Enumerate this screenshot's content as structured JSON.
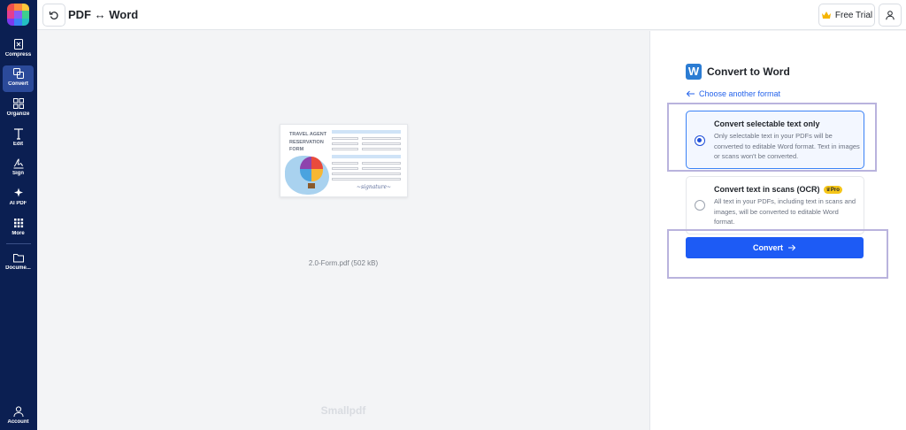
{
  "header": {
    "title": "PDF ↔ Word",
    "free_trial_label": "Free Trial"
  },
  "sidebar": {
    "items": [
      {
        "label": "Compress",
        "icon": "compress-icon"
      },
      {
        "label": "Convert",
        "icon": "convert-icon",
        "active": true
      },
      {
        "label": "Organize",
        "icon": "organize-icon"
      },
      {
        "label": "Edit",
        "icon": "edit-icon"
      },
      {
        "label": "Sign",
        "icon": "sign-icon"
      },
      {
        "label": "AI PDF",
        "icon": "ai-sparkle-icon"
      },
      {
        "label": "More",
        "icon": "grid-icon"
      },
      {
        "label": "Docume...",
        "icon": "folder-icon"
      },
      {
        "label": "Account",
        "icon": "account-icon"
      }
    ]
  },
  "preview": {
    "thumbnail_title": "TRAVEL AGENT RESERVATION FORM",
    "file_name": "2.0-Form.pdf (502 kB)",
    "watermark": "Smallpdf"
  },
  "panel": {
    "title": "Convert to Word",
    "choose_link": "Choose another format",
    "options": [
      {
        "title": "Convert selectable text only",
        "description": "Only selectable text in your PDFs will be converted to editable Word format. Text in images or scans won't be converted.",
        "selected": true
      },
      {
        "title": "Convert text in scans (OCR)",
        "badge": "Pro",
        "description": "All text in your PDFs, including text in scans and images, will be converted to editable Word format.",
        "selected": false
      }
    ],
    "convert_label": "Convert"
  },
  "colors": {
    "sidebar_bg": "#0b1f52",
    "sidebar_active": "#2b4a9a",
    "primary": "#1d5bf5",
    "link": "#2563eb",
    "pro_badge": "#f5c518",
    "highlight_frame": "#b9b3dd"
  }
}
